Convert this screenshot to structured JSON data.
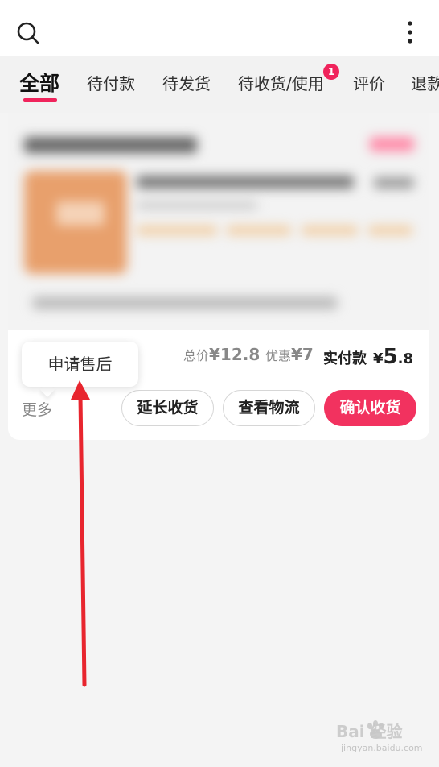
{
  "tabs": [
    {
      "label": "全部",
      "active": true
    },
    {
      "label": "待付款"
    },
    {
      "label": "待发货"
    },
    {
      "label": "待收货/使用",
      "badge": "1"
    },
    {
      "label": "评价"
    },
    {
      "label": "退款"
    }
  ],
  "order": {
    "total_label": "总价",
    "total_value": "¥12.8",
    "discount_label": "优惠",
    "discount_value": "¥7",
    "paid_label": "实付款",
    "paid_currency": "¥",
    "paid_int": "5",
    "paid_dec": ".8",
    "more_label": "更多",
    "popover_label": "申请售后",
    "buttons": {
      "extend": "延长收货",
      "logistics": "查看物流",
      "confirm": "确认收货"
    }
  },
  "watermark": {
    "brand": "Bai  经验",
    "sub": "jingyan.baidu.com"
  },
  "colors": {
    "accent": "#f2325f",
    "annotation_arrow": "#e8252e"
  },
  "icons": [
    "search-icon",
    "more-vertical-icon",
    "baidu-paw-icon"
  ]
}
